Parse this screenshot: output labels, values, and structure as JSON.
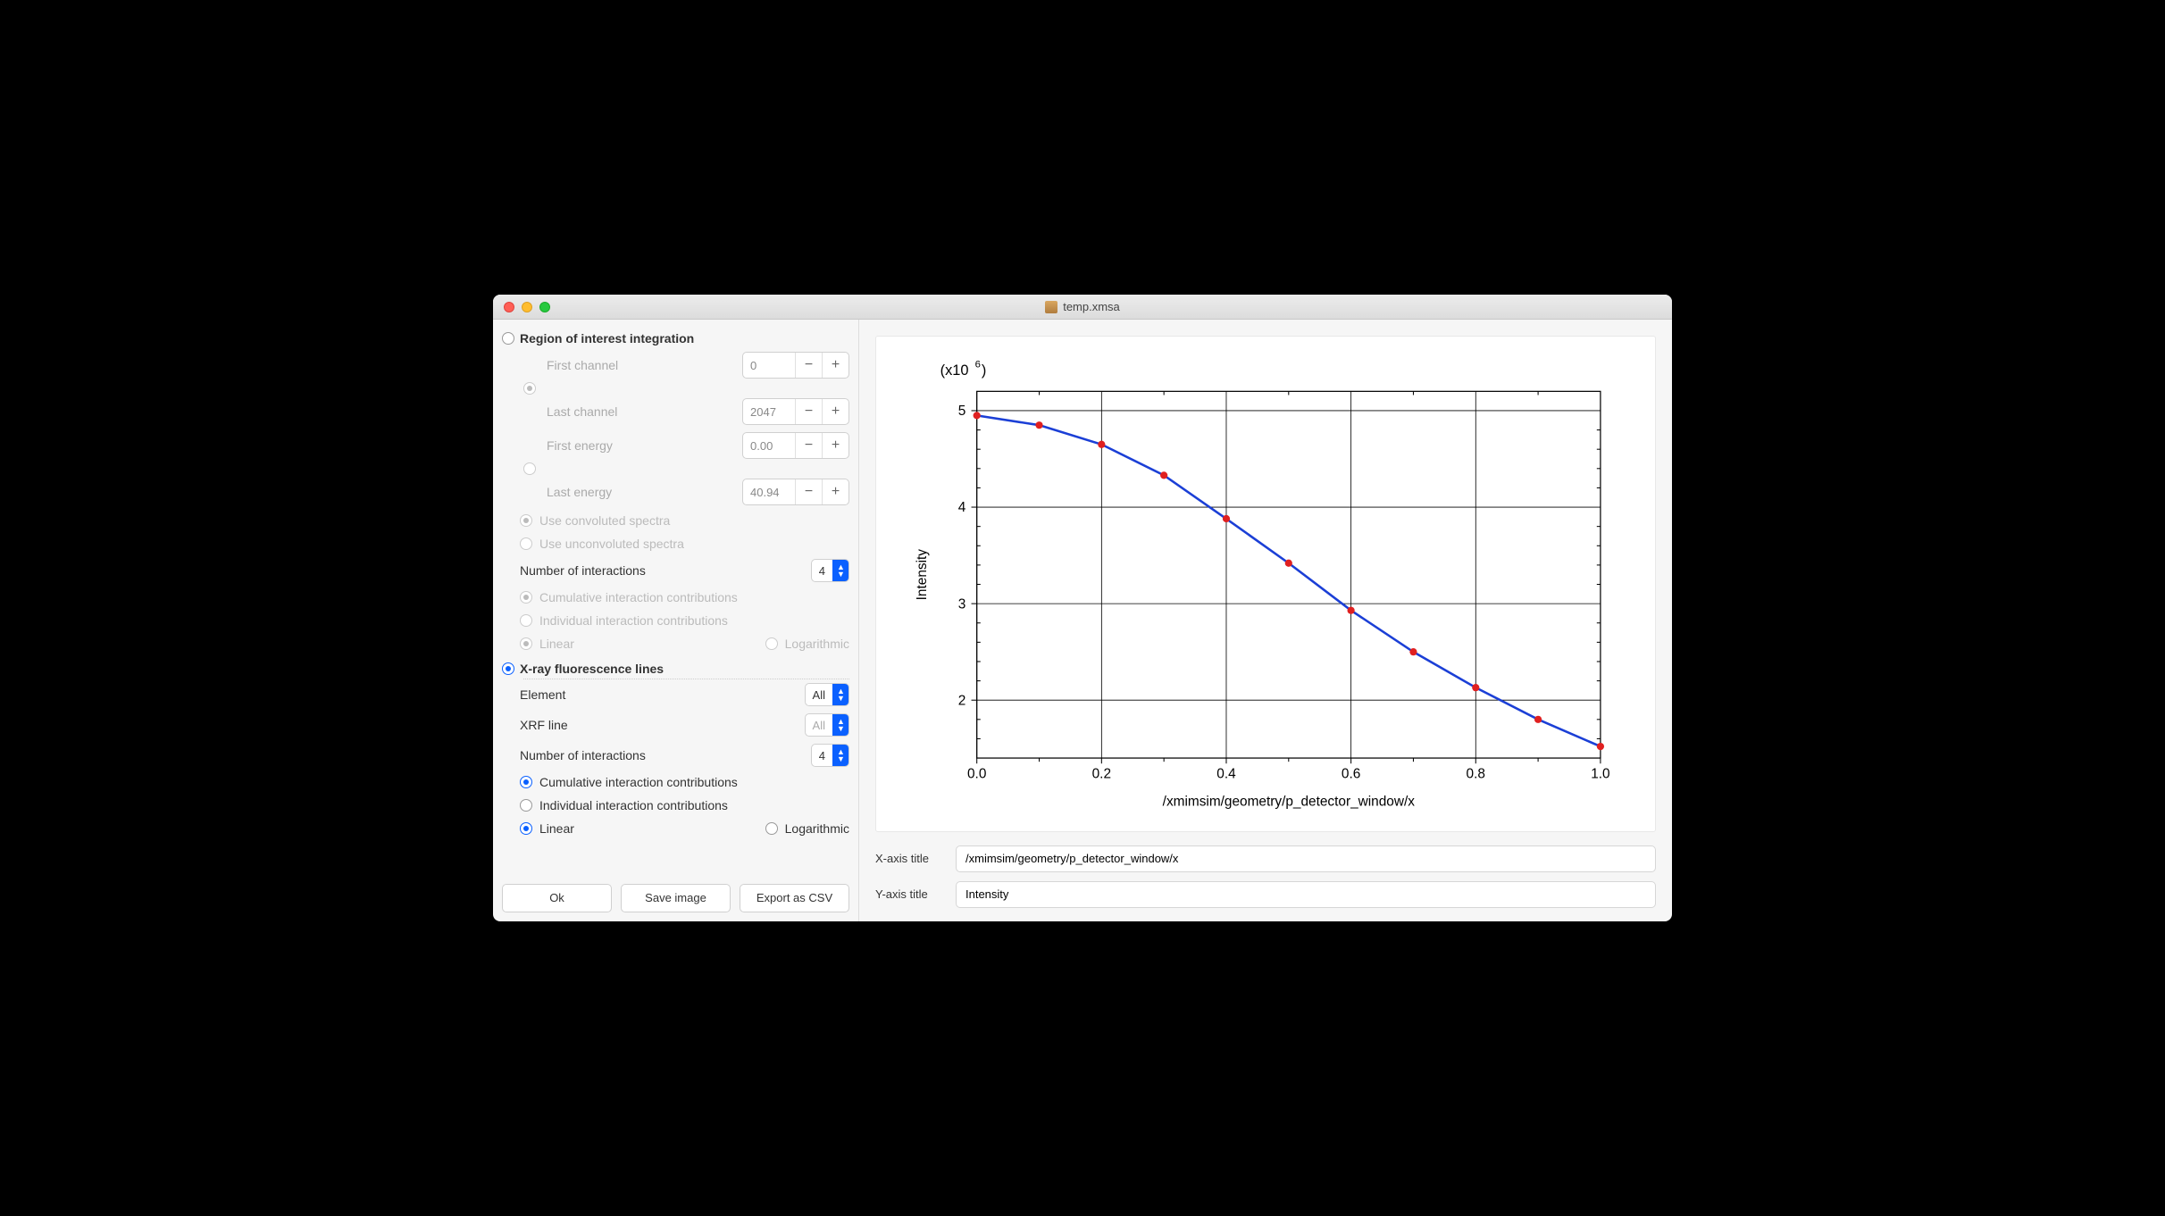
{
  "window": {
    "title": "temp.xmsa"
  },
  "roi": {
    "header": "Region of interest integration",
    "first_channel_label": "First channel",
    "first_channel_value": "0",
    "last_channel_label": "Last channel",
    "last_channel_value": "2047",
    "first_energy_label": "First energy",
    "first_energy_value": "0.00",
    "last_energy_label": "Last energy",
    "last_energy_value": "40.94",
    "use_convoluted": "Use convoluted spectra",
    "use_unconvoluted": "Use unconvoluted spectra",
    "num_interactions_label": "Number of interactions",
    "num_interactions_value": "4",
    "cumulative": "Cumulative interaction contributions",
    "individual": "Individual interaction contributions",
    "linear": "Linear",
    "logarithmic": "Logarithmic"
  },
  "xrf": {
    "header": "X-ray fluorescence lines",
    "element_label": "Element",
    "element_value": "All",
    "xrf_line_label": "XRF line",
    "xrf_line_value": "All",
    "num_interactions_label": "Number of interactions",
    "num_interactions_value": "4",
    "cumulative": "Cumulative interaction contributions",
    "individual": "Individual interaction contributions",
    "linear": "Linear",
    "logarithmic": "Logarithmic"
  },
  "buttons": {
    "ok": "Ok",
    "save_image": "Save image",
    "export_csv": "Export as CSV"
  },
  "axis_inputs": {
    "x_label": "X-axis title",
    "x_value": "/xmimsim/geometry/p_detector_window/x",
    "y_label": "Y-axis title",
    "y_value": "Intensity"
  },
  "chart_data": {
    "type": "line",
    "multiplier_label": "(x10⁶)",
    "xlabel": "/xmimsim/geometry/p_detector_window/x",
    "ylabel": "Intensity",
    "xlim": [
      0.0,
      1.0
    ],
    "ylim": [
      1.4,
      5.2
    ],
    "xticks": [
      0.0,
      0.2,
      0.4,
      0.6,
      0.8,
      1.0
    ],
    "yticks": [
      2,
      3,
      4,
      5
    ],
    "x": [
      0.0,
      0.1,
      0.2,
      0.3,
      0.4,
      0.5,
      0.6,
      0.7,
      0.8,
      0.9,
      1.0
    ],
    "y": [
      4.95,
      4.85,
      4.65,
      4.33,
      3.88,
      3.42,
      2.93,
      2.5,
      2.13,
      1.8,
      1.52
    ],
    "line_color": "#1b3fd6",
    "point_color": "#e02020"
  }
}
